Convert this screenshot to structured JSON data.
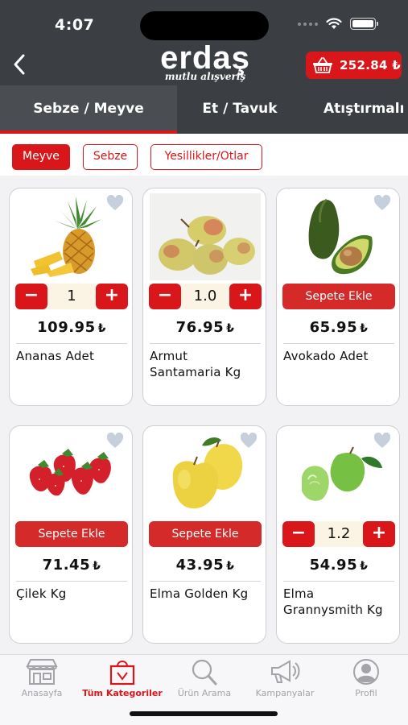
{
  "status_bar": {
    "time": "4:07"
  },
  "header": {
    "logo_brand": "erdaş",
    "logo_slogan": "mutlu alışveriş",
    "cart_total": "252.84 ₺"
  },
  "tabs": [
    {
      "label": "Sebze / Meyve",
      "active": true
    },
    {
      "label": "Et / Tavuk",
      "active": false
    },
    {
      "label": "Atıştırmalı",
      "active": false
    }
  ],
  "subcategories": [
    {
      "label": "Meyve",
      "active": true
    },
    {
      "label": "Sebze",
      "active": false
    },
    {
      "label": "Yesillikler/Otlar",
      "active": false
    }
  ],
  "add_to_cart_label": "Sepete Ekle",
  "products": [
    {
      "name": "Ananas Adet",
      "price": "109.95",
      "currency": "₺",
      "quantity": "1",
      "in_cart": true,
      "image": "pineapple"
    },
    {
      "name": "Armut Santamaria Kg",
      "price": "76.95",
      "currency": "₺",
      "quantity": "1.0",
      "in_cart": true,
      "image": "pears"
    },
    {
      "name": "Avokado Adet",
      "price": "65.95",
      "currency": "₺",
      "quantity": "",
      "in_cart": false,
      "image": "avocado"
    },
    {
      "name": "Çilek Kg",
      "price": "71.45",
      "currency": "₺",
      "quantity": "",
      "in_cart": false,
      "image": "strawberries"
    },
    {
      "name": "Elma Golden Kg",
      "price": "43.95",
      "currency": "₺",
      "quantity": "",
      "in_cart": false,
      "image": "golden-apples"
    },
    {
      "name": "Elma Grannysmith Kg",
      "price": "54.95",
      "currency": "₺",
      "quantity": "1.2",
      "in_cart": true,
      "image": "green-apples"
    }
  ],
  "bottom_nav": [
    {
      "label": "Anasayfa",
      "icon": "store-icon",
      "active": false
    },
    {
      "label": "Tüm Kategoriler",
      "icon": "shopping-bag-icon",
      "active": true
    },
    {
      "label": "Ürün Arama",
      "icon": "search-icon",
      "active": false
    },
    {
      "label": "Kampanyalar",
      "icon": "megaphone-icon",
      "active": false
    },
    {
      "label": "Profil",
      "icon": "profile-icon",
      "active": false
    }
  ],
  "colors": {
    "header": "#3b3e43",
    "accent": "#d9171b",
    "stepper_value_bg": "#fbf4e4"
  }
}
